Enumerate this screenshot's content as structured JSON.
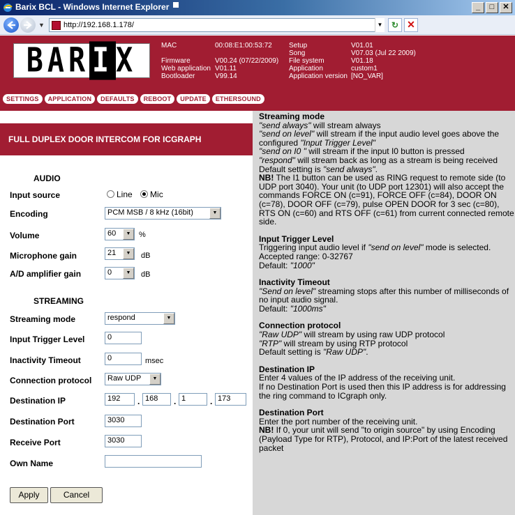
{
  "window": {
    "title": "Barix BCL - Windows Internet Explorer",
    "controls": {
      "minimize": "_",
      "maximize": "□",
      "close": "✕"
    }
  },
  "addressbar": {
    "url": "http://192.168.1.178/"
  },
  "header": {
    "logo": "BAR|X",
    "info_col1_labels": [
      "MAC",
      "",
      "Firmware",
      "Web application",
      "Bootloader"
    ],
    "info_col1_values": [
      "00:08:E1:00:53:72",
      "",
      "V00.24 (07/22/2009)",
      "V01.11",
      "V99.14"
    ],
    "info_col2_labels": [
      "Setup",
      "Song",
      "File system",
      "Application",
      "Application version"
    ],
    "info_col2_values": [
      "V01.01",
      "V07.03 (Jul 22 2009)",
      "V01.18",
      "custom1",
      "[NO_VAR]"
    ],
    "menu": [
      "SETTINGS",
      "APPLICATION",
      "DEFAULTS",
      "REBOOT",
      "UPDATE",
      "ETHERSOUND"
    ]
  },
  "form": {
    "title": "FULL DUPLEX DOOR INTERCOM FOR ICGRAPH",
    "audio_section": "AUDIO",
    "input_source_label": "Input source",
    "input_source_options": [
      "Line",
      "Mic"
    ],
    "input_source_selected": "Mic",
    "encoding_label": "Encoding",
    "encoding_value": "PCM MSB / 8 kHz (16bit)",
    "volume_label": "Volume",
    "volume_value": "60",
    "volume_unit": "%",
    "mic_gain_label": "Microphone gain",
    "mic_gain_value": "21",
    "mic_gain_unit": "dB",
    "ad_gain_label": "A/D amplifier gain",
    "ad_gain_value": "0",
    "ad_gain_unit": "dB",
    "streaming_section": "STREAMING",
    "streaming_mode_label": "Streaming mode",
    "streaming_mode_value": "respond",
    "trigger_label": "Input Trigger Level",
    "trigger_value": "0",
    "inactivity_label": "Inactivity Timeout",
    "inactivity_value": "0",
    "inactivity_unit": "msec",
    "protocol_label": "Connection protocol",
    "protocol_value": "Raw UDP",
    "dest_ip_label": "Destination IP",
    "dest_ip": [
      "192",
      "168",
      "1",
      "173"
    ],
    "dest_port_label": "Destination Port",
    "dest_port_value": "3030",
    "recv_port_label": "Receive Port",
    "recv_port_value": "3030",
    "own_name_label": "Own Name",
    "own_name_value": "",
    "apply_label": "Apply",
    "cancel_label": "Cancel"
  },
  "help": {
    "streaming_title": "Streaming mode",
    "streaming_l1_em": "\"send always\"",
    "streaming_l1": " will stream always",
    "streaming_l2_em": "\"send on level\"",
    "streaming_l2": " will stream if the input audio level goes above the configured ",
    "streaming_l2_em2": "\"Input Trigger Level\"",
    "streaming_l3_em": "\"send on I0 \"",
    "streaming_l3": " will stream if the input I0 button is pressed",
    "streaming_l4_em": "\"respond\"",
    "streaming_l4": " will stream back as long as a stream is being received",
    "streaming_l5": "Default setting is ",
    "streaming_l5_em": "\"send always\"",
    "streaming_nb": "NB!",
    "streaming_nb_text": " The I1 button can be used as RING request to remote side (to UDP port 3040). Your unit (to UDP port 12301) will also accept the commands FORCE ON (c=91), FORCE OFF (c=84), DOOR ON (c=78), DOOR OFF (c=79), pulse OPEN DOOR for 3 sec (c=80), RTS ON (c=60) and RTS OFF (c=61) from current connected remote side.",
    "trigger_title": "Input Trigger Level",
    "trigger_l1": "Triggering input audio level if ",
    "trigger_l1_em": "\"send on level\"",
    "trigger_l1b": " mode is selected.",
    "trigger_l2": "Accepted range: 0-32767",
    "trigger_l3": "Default: ",
    "trigger_l3_em": "\"1000\"",
    "inactivity_title": "Inactivity Timeout",
    "inactivity_l1_em": "\"Send on level\"",
    "inactivity_l1": " streaming stops after this number of milliseconds of no input audio signal.",
    "inactivity_l2": "Default: ",
    "inactivity_l2_em": "\"1000ms\"",
    "protocol_title": "Connection protocol",
    "protocol_l1_em": "\"Raw UDP\"",
    "protocol_l1": " will stream by using raw UDP protocol",
    "protocol_l2_em": "\"RTP\"",
    "protocol_l2": " will stream by using RTP protocol",
    "protocol_l3": "Default setting is ",
    "protocol_l3_em": "\"Raw UDP\"",
    "destip_title": "Destination IP",
    "destip_l1": "Enter 4 values of the IP address of the receiving unit.",
    "destip_l2": "If no Destination Port is used then this IP address is for addressing the ring command to ICgraph only.",
    "destport_title": "Destination Port",
    "destport_l1": "Enter the port number of the receiving unit.",
    "destport_nb": "NB!",
    "destport_nb_text": " If 0, your unit will send \"to origin source\" by using Encoding (Payload Type for RTP), Protocol, and IP:Port of the latest received packet"
  }
}
